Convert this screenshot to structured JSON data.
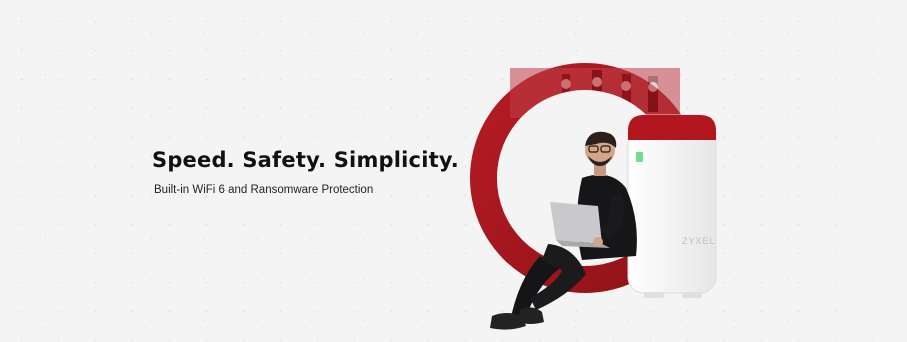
{
  "hero_banner": {
    "headline": "Speed. Safety. Simplicity.",
    "subheadline": "Built-in WiFi 6 and Ransomware Protection",
    "device_brand": "ZYXEL"
  },
  "colors": {
    "accent_red": "#a4161d",
    "background": "#f4f4f4",
    "text": "#111111",
    "status_led": "#6fe08a"
  }
}
